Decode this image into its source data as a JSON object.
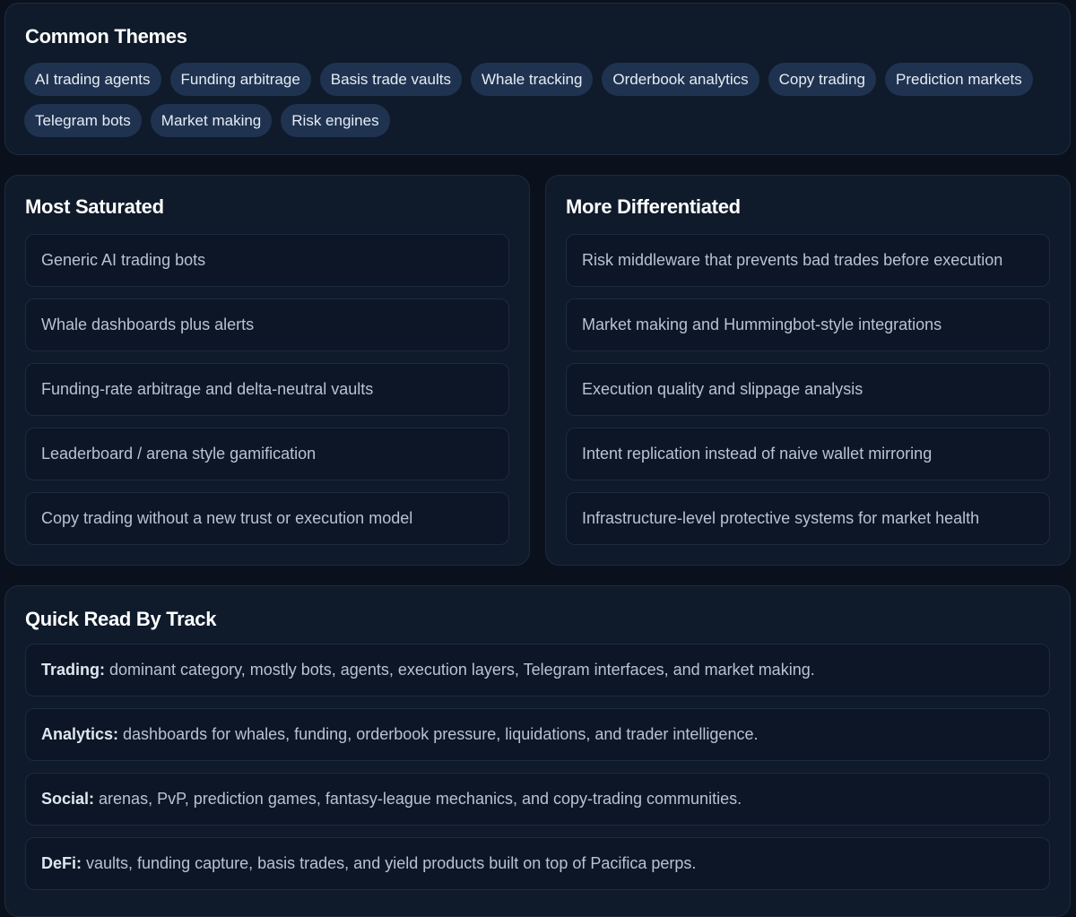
{
  "themes": {
    "title": "Common Themes",
    "chips": [
      "AI trading agents",
      "Funding arbitrage",
      "Basis trade vaults",
      "Whale tracking",
      "Orderbook analytics",
      "Copy trading",
      "Prediction markets",
      "Telegram bots",
      "Market making",
      "Risk engines"
    ]
  },
  "saturated": {
    "title": "Most Saturated",
    "items": [
      "Generic AI trading bots",
      "Whale dashboards plus alerts",
      "Funding-rate arbitrage and delta-neutral vaults",
      "Leaderboard / arena style gamification",
      "Copy trading without a new trust or execution model"
    ]
  },
  "differentiated": {
    "title": "More Differentiated",
    "items": [
      "Risk middleware that prevents bad trades before execution",
      "Market making and Hummingbot-style integrations",
      "Execution quality and slippage analysis",
      "Intent replication instead of naive wallet mirroring",
      "Infrastructure-level protective systems for market health"
    ]
  },
  "quickread": {
    "title": "Quick Read By Track",
    "tracks": [
      {
        "label": "Trading:",
        "text": " dominant category, mostly bots, agents, execution layers, Telegram interfaces, and market making."
      },
      {
        "label": "Analytics:",
        "text": " dashboards for whales, funding, orderbook pressure, liquidations, and trader intelligence."
      },
      {
        "label": "Social:",
        "text": " arenas, PvP, prediction games, fantasy-league mechanics, and copy-trading communities."
      },
      {
        "label": "DeFi:",
        "text": " vaults, funding capture, basis trades, and yield products built on top of Pacifica perps."
      }
    ]
  }
}
